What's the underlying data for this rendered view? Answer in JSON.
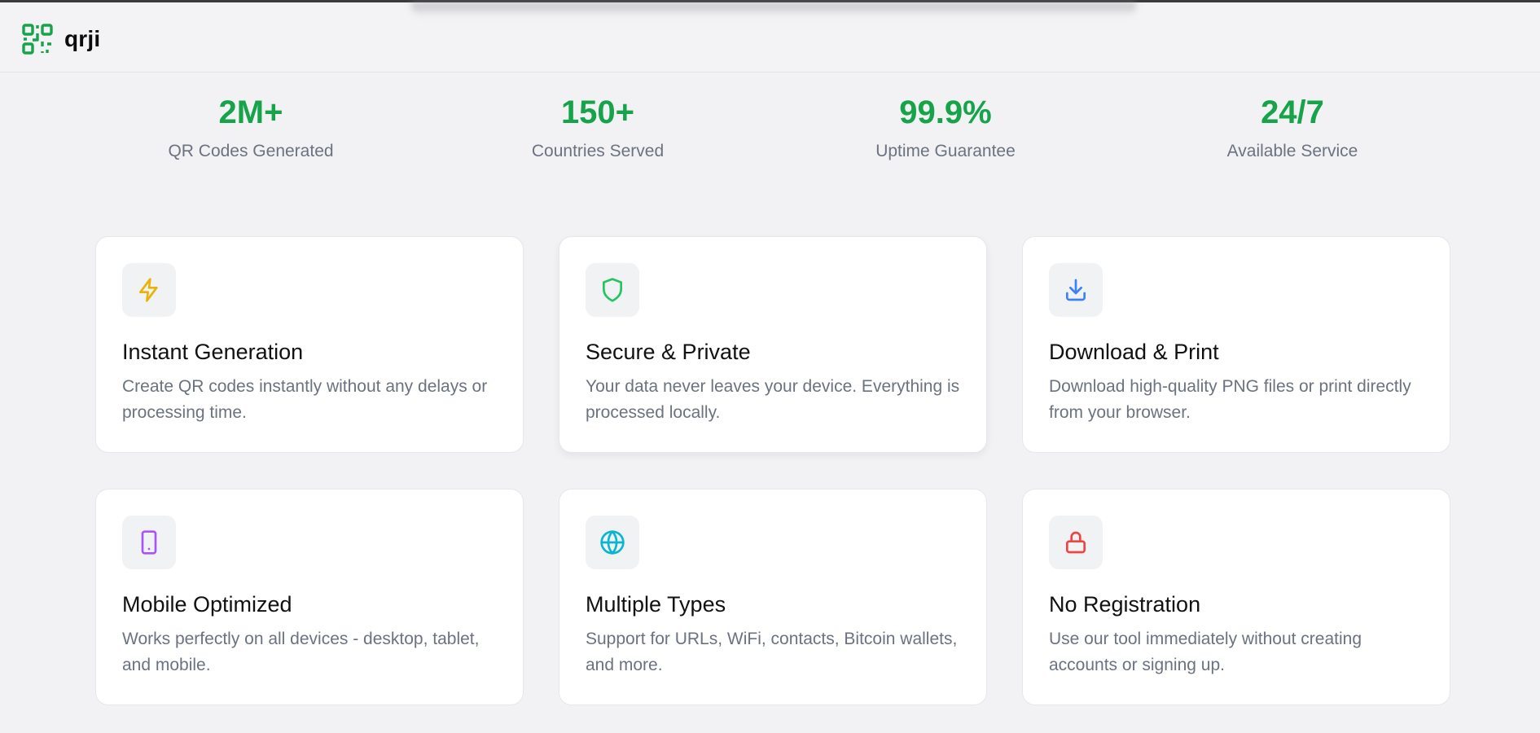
{
  "brand": {
    "name": "qrji",
    "logo_icon": "qr-code-icon",
    "accent": "#16a34a"
  },
  "stats": [
    {
      "value": "2M+",
      "label": "QR Codes Generated"
    },
    {
      "value": "150+",
      "label": "Countries Served"
    },
    {
      "value": "99.9%",
      "label": "Uptime Guarantee"
    },
    {
      "value": "24/7",
      "label": "Available Service"
    }
  ],
  "features": [
    {
      "icon": "lightning-icon",
      "color": "#eab308",
      "title": "Instant Generation",
      "description": "Create QR codes instantly without any delays or processing time."
    },
    {
      "icon": "shield-icon",
      "color": "#22c55e",
      "title": "Secure & Private",
      "description": "Your data never leaves your device. Everything is processed locally."
    },
    {
      "icon": "download-icon",
      "color": "#3b82f6",
      "title": "Download & Print",
      "description": "Download high-quality PNG files or print directly from your browser."
    },
    {
      "icon": "mobile-icon",
      "color": "#a855f7",
      "title": "Mobile Optimized",
      "description": "Works perfectly on all devices - desktop, tablet, and mobile."
    },
    {
      "icon": "globe-icon",
      "color": "#06b6d4",
      "title": "Multiple Types",
      "description": "Support for URLs, WiFi, contacts, Bitcoin wallets, and more."
    },
    {
      "icon": "lock-icon",
      "color": "#ef4444",
      "title": "No Registration",
      "description": "Use our tool immediately without creating accounts or signing up."
    }
  ]
}
